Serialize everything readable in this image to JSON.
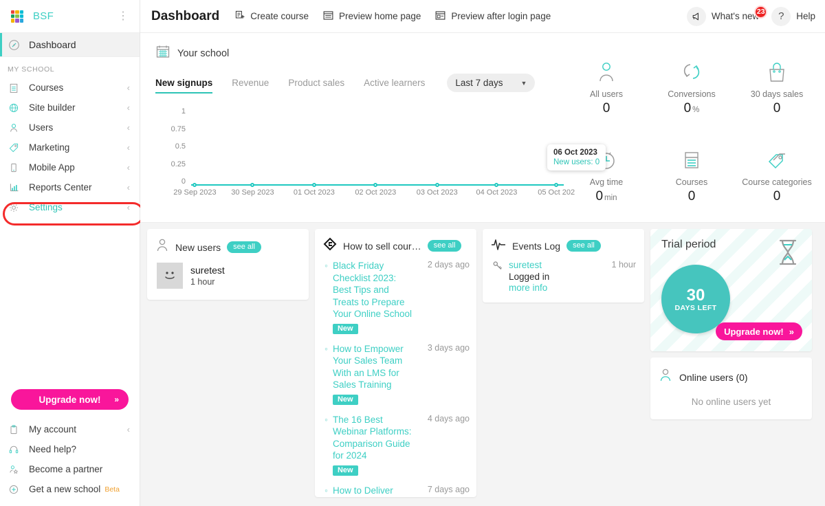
{
  "brand": {
    "name": "BSF",
    "menu_icon": "kebab-menu-icon",
    "logo_colors": [
      "#e8453c",
      "#f4b400",
      "#f4b400",
      "#2aa7de",
      "#1aa260",
      "#8bc34a",
      "#2aa7de",
      "#f4b400",
      "#9b59d0"
    ]
  },
  "sidebar": {
    "dashboard": {
      "label": "Dashboard",
      "icon": "speedometer-icon"
    },
    "section_label": "MY SCHOOL",
    "items": [
      {
        "label": "Courses",
        "icon": "book-icon",
        "chevron": "‹"
      },
      {
        "label": "Site builder",
        "icon": "globe-icon",
        "chevron": "‹"
      },
      {
        "label": "Users",
        "icon": "user-icon",
        "chevron": "‹"
      },
      {
        "label": "Marketing",
        "icon": "tag-icon",
        "chevron": "‹"
      },
      {
        "label": "Mobile App",
        "icon": "mobile-icon",
        "chevron": "‹"
      },
      {
        "label": "Reports Center",
        "icon": "bar-chart-icon",
        "chevron": "‹"
      },
      {
        "label": "Settings",
        "icon": "gear-icon",
        "chevron": "‹"
      }
    ],
    "upgrade": {
      "label": "Upgrade now!",
      "arrows": "»"
    },
    "bottom_items": [
      {
        "label": "My account",
        "icon": "clipboard-icon",
        "chevron": "‹"
      },
      {
        "label": "Need help?",
        "icon": "headset-icon",
        "chevron": ""
      },
      {
        "label": "Become a partner",
        "icon": "partner-icon",
        "chevron": ""
      },
      {
        "label": "Get a new school",
        "icon": "plus-circle-icon",
        "chevron": "",
        "badge": "Beta"
      }
    ],
    "highlight_color": "#f42b2b"
  },
  "topbar": {
    "title": "Dashboard",
    "actions": [
      {
        "label": "Create course",
        "icon": "document-plus-icon"
      },
      {
        "label": "Preview home page",
        "icon": "browser-icon"
      },
      {
        "label": "Preview after login page",
        "icon": "browser-login-icon"
      }
    ],
    "whats_new": {
      "label": "What's new",
      "icon": "megaphone-icon",
      "badge": "23"
    },
    "help": {
      "label": "Help",
      "icon": "question-icon"
    }
  },
  "overview": {
    "school_label": "Your school",
    "school_icon": "calendar-icon",
    "tabs": [
      {
        "label": "New signups",
        "active": true
      },
      {
        "label": "Revenue",
        "active": false
      },
      {
        "label": "Product sales",
        "active": false
      },
      {
        "label": "Active learners",
        "active": false
      }
    ],
    "range": {
      "value": "Last 7 days",
      "caret": "▼"
    },
    "tooltip": {
      "date": "06 Oct 2023",
      "value": "New users: 0"
    },
    "stats": [
      {
        "label": "All users",
        "value": "0",
        "unit": "",
        "icon": "user-icon"
      },
      {
        "label": "Conversions",
        "value": "0",
        "unit": "%",
        "icon": "conversion-arrows-icon"
      },
      {
        "label": "30 days sales",
        "value": "0",
        "unit": "",
        "icon": "shopping-bag-icon"
      },
      {
        "label": "Avg time",
        "value": "0",
        "unit": "min",
        "icon": "clock-icon"
      },
      {
        "label": "Courses",
        "value": "0",
        "unit": "",
        "icon": "course-card-icon"
      },
      {
        "label": "Course categories",
        "value": "0",
        "unit": "",
        "icon": "price-tag-icon"
      }
    ]
  },
  "chart_data": {
    "type": "line",
    "title": "New signups",
    "xlabel": "",
    "ylabel": "",
    "x": [
      "29 Sep 2023",
      "30 Sep 2023",
      "01 Oct 2023",
      "02 Oct 2023",
      "03 Oct 2023",
      "04 Oct 2023",
      "05 Oct 202"
    ],
    "categories": [
      "29 Sep 2023",
      "30 Sep 2023",
      "01 Oct 2023",
      "02 Oct 2023",
      "03 Oct 2023",
      "04 Oct 2023",
      "05 Oct 202"
    ],
    "values": [
      0,
      0,
      0,
      0,
      0,
      0,
      0
    ],
    "series": [
      {
        "name": "New users",
        "values": [
          0,
          0,
          0,
          0,
          0,
          0,
          0
        ]
      }
    ],
    "yticks": [
      "1",
      "0.75",
      "0.5",
      "0.25",
      "0"
    ],
    "ylim": [
      0,
      1
    ],
    "grid": false,
    "legend": "none",
    "line_color": "#1fc8c0"
  },
  "cards": {
    "new_users": {
      "title": "New users",
      "icon": "user-icon",
      "see_all": "see all",
      "users": [
        {
          "name": "suretest",
          "time": "1 hour",
          "avatar": "smiley-avatar"
        }
      ]
    },
    "blog": {
      "title": "How to sell cour…",
      "icon": "ribbon-icon",
      "see_all": "see all",
      "posts": [
        {
          "title": "Black Friday Checklist 2023: Best Tips and Treats to Prepare Your Online School",
          "ago": "2 days ago",
          "tag": "New"
        },
        {
          "title": "How to Empower Your Sales Team With an LMS for Sales Training",
          "ago": "3 days ago",
          "tag": "New"
        },
        {
          "title": "The 16 Best Webinar Platforms: Comparison Guide for 2024",
          "ago": "4 days ago",
          "tag": "New"
        },
        {
          "title": "How to Deliver",
          "ago": "7 days ago",
          "tag": ""
        }
      ]
    },
    "events": {
      "title": "Events Log",
      "icon": "pulse-icon",
      "see_all": "see all",
      "rows": [
        {
          "user": "suretest",
          "action": "Logged in",
          "more": "more info",
          "ago": "1 hour",
          "icon": "key-icon"
        }
      ]
    },
    "trial": {
      "title": "Trial period",
      "icon": "hourglass-icon",
      "days": "30",
      "days_label": "DAYS LEFT",
      "upgrade": "Upgrade now!",
      "arrows": "»",
      "accent": "#46c5be",
      "cta_color": "#f9169b"
    },
    "online": {
      "title": "Online users (0)",
      "icon": "user-icon",
      "empty": "No online users yet"
    }
  }
}
